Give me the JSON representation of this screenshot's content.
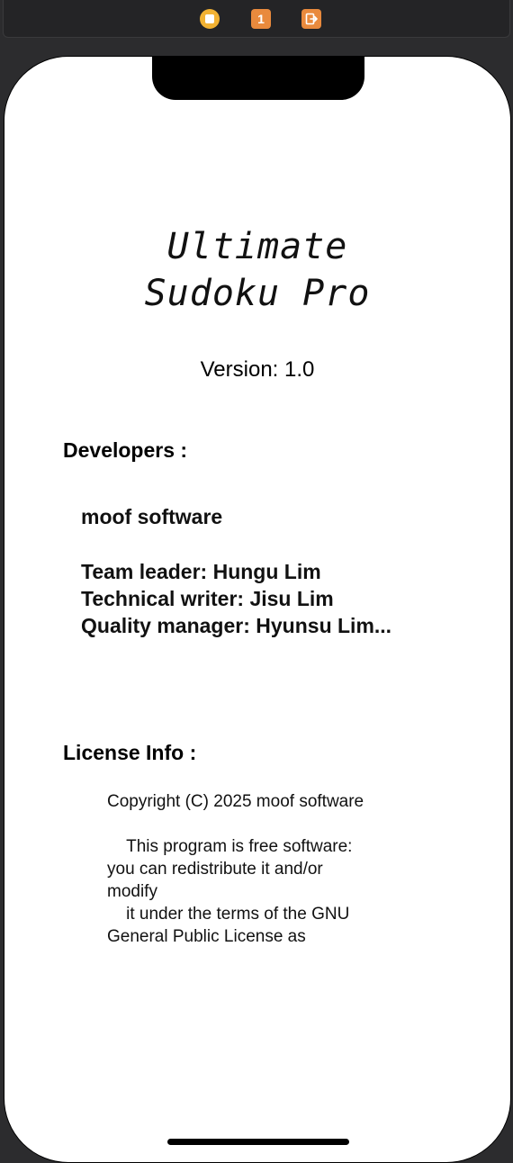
{
  "toolbar": {
    "stop_icon": "stop-icon",
    "badge_count": "1",
    "exit_icon": "exit-icon"
  },
  "about": {
    "app_title_line1": "Ultimate",
    "app_title_line2": "Sudoku Pro",
    "version": "Version: 1.0",
    "developers_heading": "Developers :",
    "company": "moof software",
    "team_leader": "Team leader: Hungu Lim",
    "technical_writer": "Technical writer: Jisu Lim",
    "quality_manager": "Quality manager: Hyunsu Lim...",
    "license_heading": "License Info :",
    "license_text": "Copyright (C) 2025 moof software\n\n    This program is free software:\nyou can redistribute it and/or\nmodify\n    it under the terms of the GNU\nGeneral Public License as"
  },
  "colors": {
    "toolbar_orange": "#e98a3d",
    "toolbar_yellow": "#f2b233"
  }
}
